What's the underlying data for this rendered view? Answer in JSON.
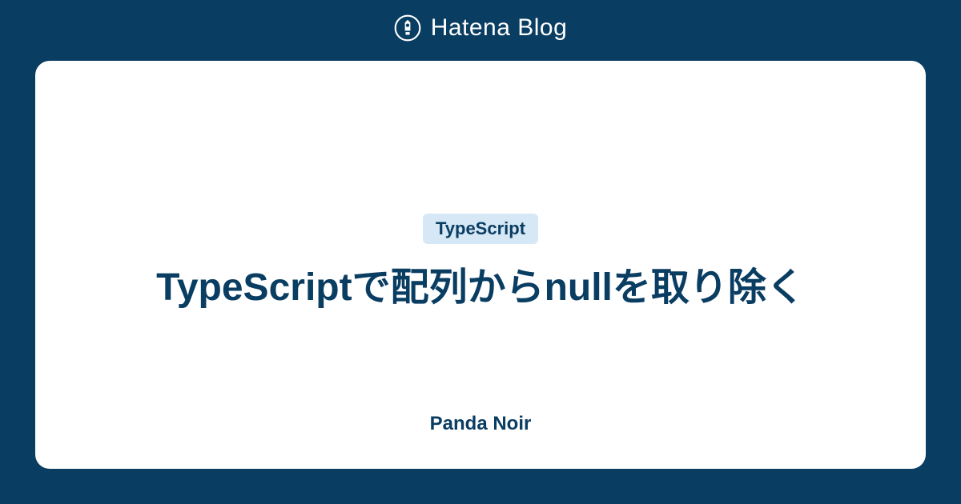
{
  "header": {
    "brand": "Hatena Blog"
  },
  "card": {
    "tag": "TypeScript",
    "title": "TypeScriptで配列からnullを取り除く",
    "author": "Panda Noir"
  }
}
